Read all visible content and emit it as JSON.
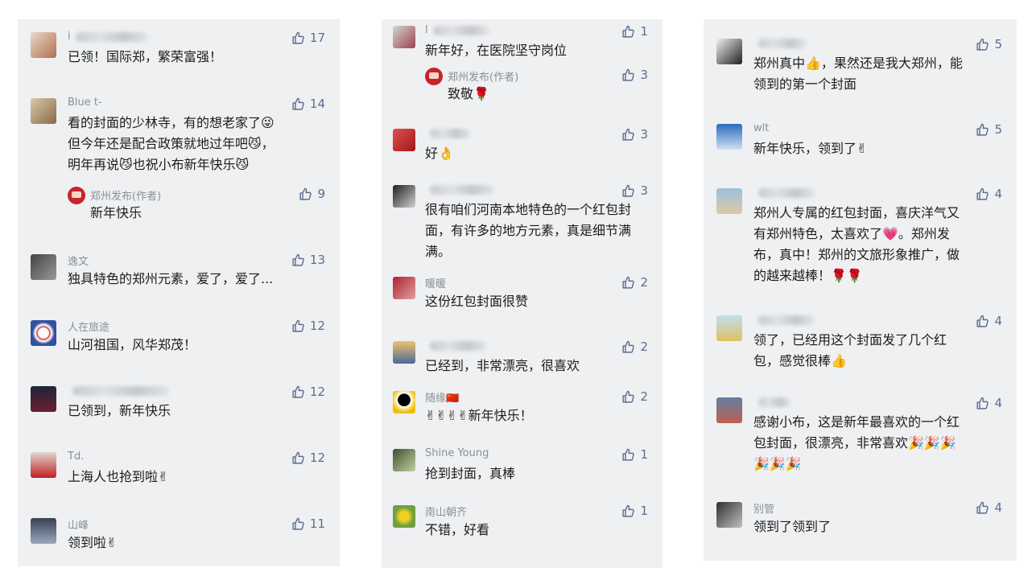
{
  "panels": [
    {
      "comments": [
        {
          "name": "i",
          "likes": "17",
          "text": "已领！国际郑，繁荣富强！"
        },
        {
          "name": "Blue t-",
          "likes": "14",
          "text": "看的封面的少林寺，有的想老家了😜\n但今年还是配合政策就地过年吧😼，\n明年再说😼也祝小布新年快乐😼",
          "reply": {
            "name": "郑州发布(作者)",
            "likes": "9",
            "text": "新年快乐"
          }
        },
        {
          "name": "逸文",
          "likes": "13",
          "text": "独具特色的郑州元素，爱了，爱了..."
        },
        {
          "name": "人在旅途",
          "likes": "12",
          "text": "山河祖国，风华郑茂！"
        },
        {
          "name": "",
          "likes": "12",
          "text": "已领到，新年快乐"
        },
        {
          "name": "Td.",
          "likes": "12",
          "text": "上海人也抢到啦✌"
        },
        {
          "name": "山峰",
          "likes": "11",
          "text": "领到啦✌"
        }
      ]
    },
    {
      "comments": [
        {
          "name": "l",
          "likes": "1",
          "text": "新年好，在医院坚守岗位",
          "reply": {
            "name": "郑州发布(作者)",
            "likes": "3",
            "text": "致敬🌹"
          }
        },
        {
          "name": "",
          "likes": "3",
          "text": "好👌"
        },
        {
          "name": "",
          "likes": "3",
          "text": "很有咱们河南本地特色的一个红包封\n面，有许多的地方元素，真是细节满\n满。"
        },
        {
          "name": "暖暖",
          "likes": "2",
          "text": "这份红包封面很赞"
        },
        {
          "name": "",
          "likes": "2",
          "text": "已经到，非常漂亮，很喜欢"
        },
        {
          "name": "随缘🇨🇳",
          "likes": "2",
          "text": "✌✌✌✌新年快乐！"
        },
        {
          "name": "Shine Young",
          "likes": "1",
          "text": "抢到封面，真棒"
        },
        {
          "name": "南山朝齐",
          "likes": "1",
          "text": "不错，好看"
        }
      ]
    },
    {
      "comments": [
        {
          "name": "",
          "likes": "5",
          "text": "郑州真中👍，果然还是我大郑州，能\n领到的第一个封面"
        },
        {
          "name": "wlt",
          "likes": "5",
          "text": "新年快乐，领到了✌"
        },
        {
          "name": "",
          "likes": "4",
          "text": "郑州人专属的红包封面，喜庆洋气又\n有郑州特色，太喜欢了💗。郑州发\n布，真中！郑州的文旅形象推广，做\n的越来越棒！🌹🌹"
        },
        {
          "name": "",
          "likes": "4",
          "text": "领了，已经用这个封面发了几个红\n包，感觉很棒👍"
        },
        {
          "name": "",
          "likes": "4",
          "text": "感谢小布，这是新年最喜欢的一个红\n包封面，很漂亮，非常喜欢🎉🎉🎉\n🎉🎉🎉"
        },
        {
          "name": "别管",
          "likes": "4",
          "text": "领到了领到了"
        }
      ]
    }
  ],
  "colors": {
    "panel_bg": "#eef0f2",
    "like": "#5b6e91",
    "name": "#8a8f99",
    "text": "#1c1c1c",
    "author_avatar": "#c8242b"
  }
}
